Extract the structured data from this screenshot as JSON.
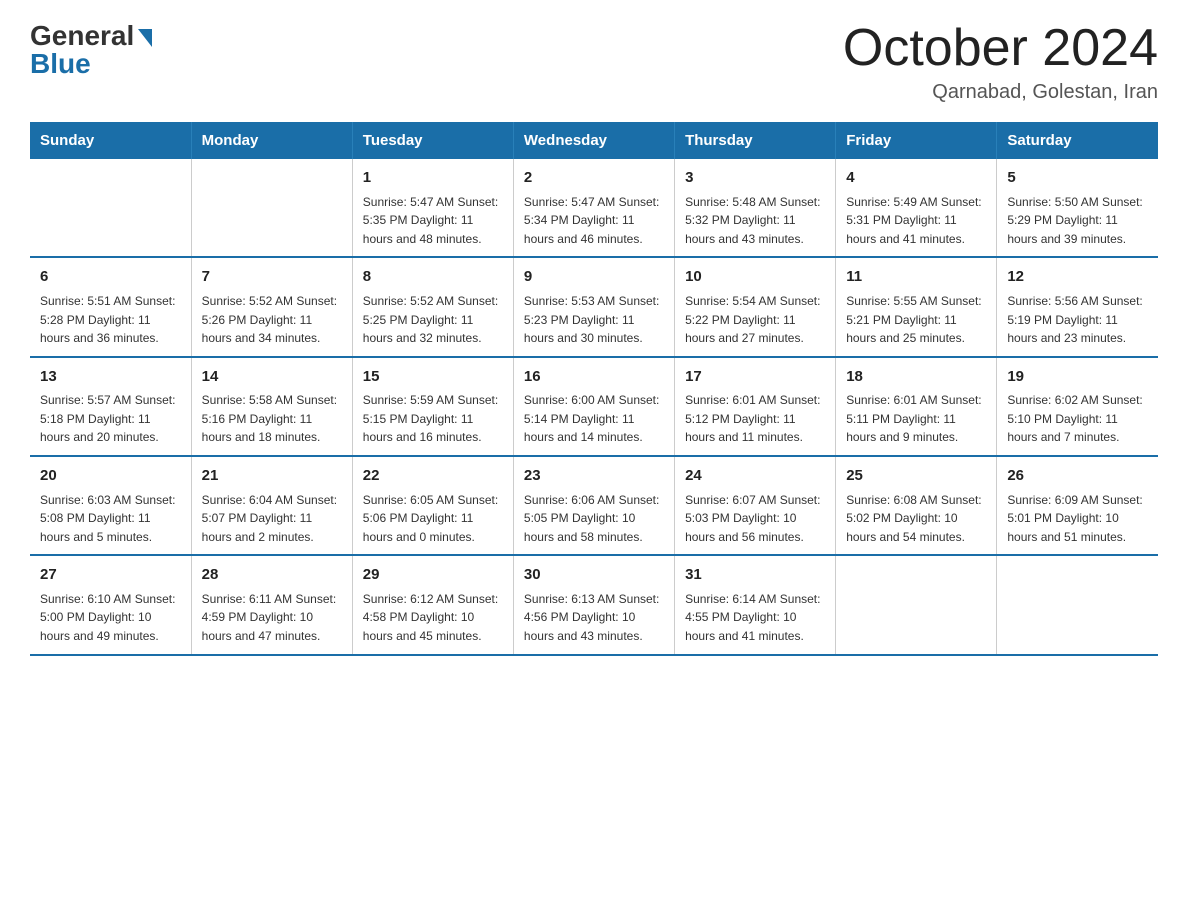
{
  "header": {
    "logo_general": "General",
    "logo_blue": "Blue",
    "month_title": "October 2024",
    "subtitle": "Qarnabad, Golestan, Iran"
  },
  "days_of_week": [
    "Sunday",
    "Monday",
    "Tuesday",
    "Wednesday",
    "Thursday",
    "Friday",
    "Saturday"
  ],
  "weeks": [
    [
      {
        "day": "",
        "info": ""
      },
      {
        "day": "",
        "info": ""
      },
      {
        "day": "1",
        "info": "Sunrise: 5:47 AM\nSunset: 5:35 PM\nDaylight: 11 hours\nand 48 minutes."
      },
      {
        "day": "2",
        "info": "Sunrise: 5:47 AM\nSunset: 5:34 PM\nDaylight: 11 hours\nand 46 minutes."
      },
      {
        "day": "3",
        "info": "Sunrise: 5:48 AM\nSunset: 5:32 PM\nDaylight: 11 hours\nand 43 minutes."
      },
      {
        "day": "4",
        "info": "Sunrise: 5:49 AM\nSunset: 5:31 PM\nDaylight: 11 hours\nand 41 minutes."
      },
      {
        "day": "5",
        "info": "Sunrise: 5:50 AM\nSunset: 5:29 PM\nDaylight: 11 hours\nand 39 minutes."
      }
    ],
    [
      {
        "day": "6",
        "info": "Sunrise: 5:51 AM\nSunset: 5:28 PM\nDaylight: 11 hours\nand 36 minutes."
      },
      {
        "day": "7",
        "info": "Sunrise: 5:52 AM\nSunset: 5:26 PM\nDaylight: 11 hours\nand 34 minutes."
      },
      {
        "day": "8",
        "info": "Sunrise: 5:52 AM\nSunset: 5:25 PM\nDaylight: 11 hours\nand 32 minutes."
      },
      {
        "day": "9",
        "info": "Sunrise: 5:53 AM\nSunset: 5:23 PM\nDaylight: 11 hours\nand 30 minutes."
      },
      {
        "day": "10",
        "info": "Sunrise: 5:54 AM\nSunset: 5:22 PM\nDaylight: 11 hours\nand 27 minutes."
      },
      {
        "day": "11",
        "info": "Sunrise: 5:55 AM\nSunset: 5:21 PM\nDaylight: 11 hours\nand 25 minutes."
      },
      {
        "day": "12",
        "info": "Sunrise: 5:56 AM\nSunset: 5:19 PM\nDaylight: 11 hours\nand 23 minutes."
      }
    ],
    [
      {
        "day": "13",
        "info": "Sunrise: 5:57 AM\nSunset: 5:18 PM\nDaylight: 11 hours\nand 20 minutes."
      },
      {
        "day": "14",
        "info": "Sunrise: 5:58 AM\nSunset: 5:16 PM\nDaylight: 11 hours\nand 18 minutes."
      },
      {
        "day": "15",
        "info": "Sunrise: 5:59 AM\nSunset: 5:15 PM\nDaylight: 11 hours\nand 16 minutes."
      },
      {
        "day": "16",
        "info": "Sunrise: 6:00 AM\nSunset: 5:14 PM\nDaylight: 11 hours\nand 14 minutes."
      },
      {
        "day": "17",
        "info": "Sunrise: 6:01 AM\nSunset: 5:12 PM\nDaylight: 11 hours\nand 11 minutes."
      },
      {
        "day": "18",
        "info": "Sunrise: 6:01 AM\nSunset: 5:11 PM\nDaylight: 11 hours\nand 9 minutes."
      },
      {
        "day": "19",
        "info": "Sunrise: 6:02 AM\nSunset: 5:10 PM\nDaylight: 11 hours\nand 7 minutes."
      }
    ],
    [
      {
        "day": "20",
        "info": "Sunrise: 6:03 AM\nSunset: 5:08 PM\nDaylight: 11 hours\nand 5 minutes."
      },
      {
        "day": "21",
        "info": "Sunrise: 6:04 AM\nSunset: 5:07 PM\nDaylight: 11 hours\nand 2 minutes."
      },
      {
        "day": "22",
        "info": "Sunrise: 6:05 AM\nSunset: 5:06 PM\nDaylight: 11 hours\nand 0 minutes."
      },
      {
        "day": "23",
        "info": "Sunrise: 6:06 AM\nSunset: 5:05 PM\nDaylight: 10 hours\nand 58 minutes."
      },
      {
        "day": "24",
        "info": "Sunrise: 6:07 AM\nSunset: 5:03 PM\nDaylight: 10 hours\nand 56 minutes."
      },
      {
        "day": "25",
        "info": "Sunrise: 6:08 AM\nSunset: 5:02 PM\nDaylight: 10 hours\nand 54 minutes."
      },
      {
        "day": "26",
        "info": "Sunrise: 6:09 AM\nSunset: 5:01 PM\nDaylight: 10 hours\nand 51 minutes."
      }
    ],
    [
      {
        "day": "27",
        "info": "Sunrise: 6:10 AM\nSunset: 5:00 PM\nDaylight: 10 hours\nand 49 minutes."
      },
      {
        "day": "28",
        "info": "Sunrise: 6:11 AM\nSunset: 4:59 PM\nDaylight: 10 hours\nand 47 minutes."
      },
      {
        "day": "29",
        "info": "Sunrise: 6:12 AM\nSunset: 4:58 PM\nDaylight: 10 hours\nand 45 minutes."
      },
      {
        "day": "30",
        "info": "Sunrise: 6:13 AM\nSunset: 4:56 PM\nDaylight: 10 hours\nand 43 minutes."
      },
      {
        "day": "31",
        "info": "Sunrise: 6:14 AM\nSunset: 4:55 PM\nDaylight: 10 hours\nand 41 minutes."
      },
      {
        "day": "",
        "info": ""
      },
      {
        "day": "",
        "info": ""
      }
    ]
  ]
}
